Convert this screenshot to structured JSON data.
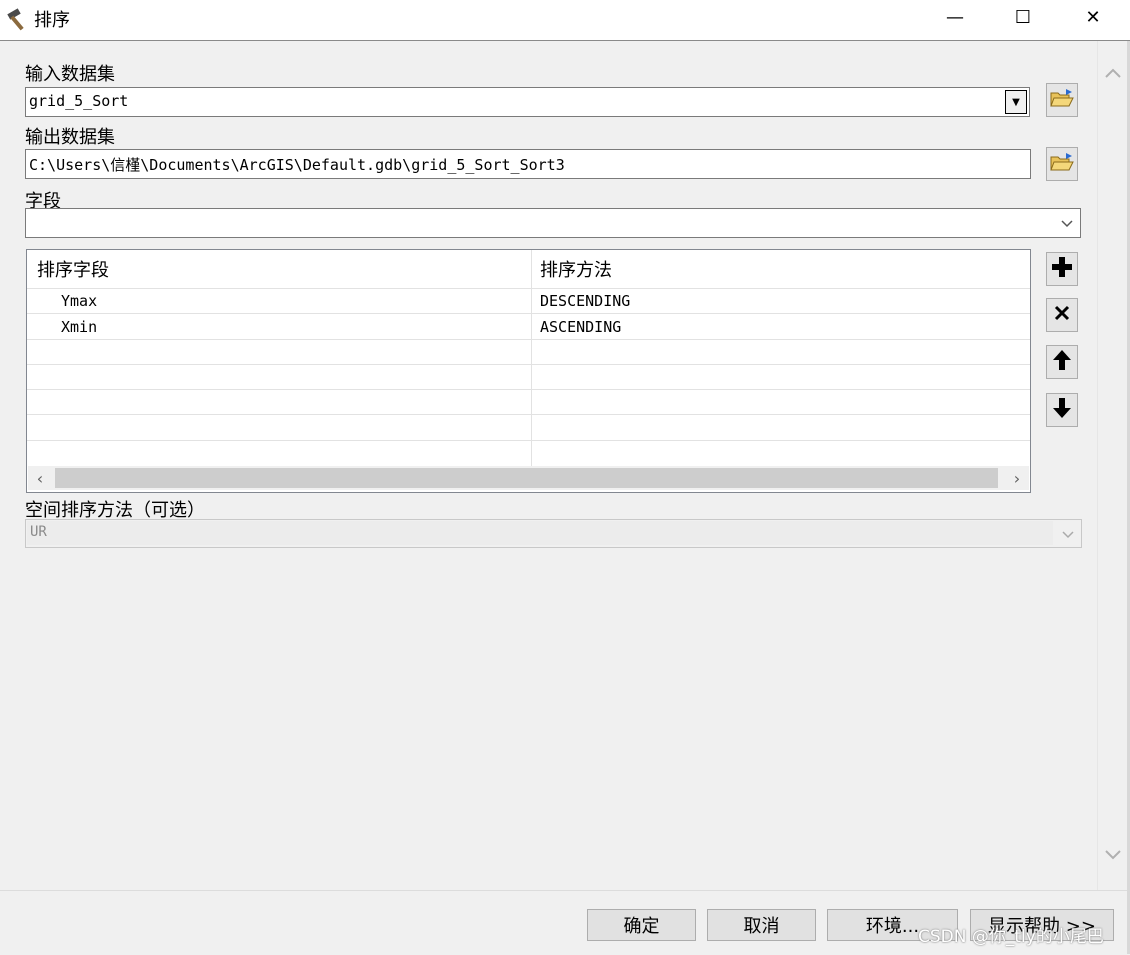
{
  "window": {
    "title": "排序",
    "minimize": "—",
    "maximize": "☐",
    "close": "✕"
  },
  "form": {
    "input_label": "输入数据集",
    "input_value": "grid_5_Sort",
    "output_label": "输出数据集",
    "output_value": "C:\\Users\\信槿\\Documents\\ArcGIS\\Default.gdb\\grid_5_Sort_Sort3",
    "field_label": "字段",
    "field_value": "",
    "spatial_label": "空间排序方法（可选）",
    "spatial_value": "UR"
  },
  "grid": {
    "columns": [
      "排序字段",
      "排序方法"
    ],
    "rows": [
      {
        "field": "Ymax",
        "method": "DESCENDING"
      },
      {
        "field": "Xmin",
        "method": "ASCENDING"
      }
    ]
  },
  "buttons": {
    "ok": "确定",
    "cancel": "取消",
    "env": "环境...",
    "help": "显示帮助 >>"
  },
  "watermark": "CSDN @你_tly的小尾巴",
  "icons": {
    "app": "hammer-icon",
    "browse": "open-folder-icon",
    "add": "plus-icon",
    "remove": "x-icon",
    "up": "arrow-up-icon",
    "down": "arrow-down-icon"
  }
}
